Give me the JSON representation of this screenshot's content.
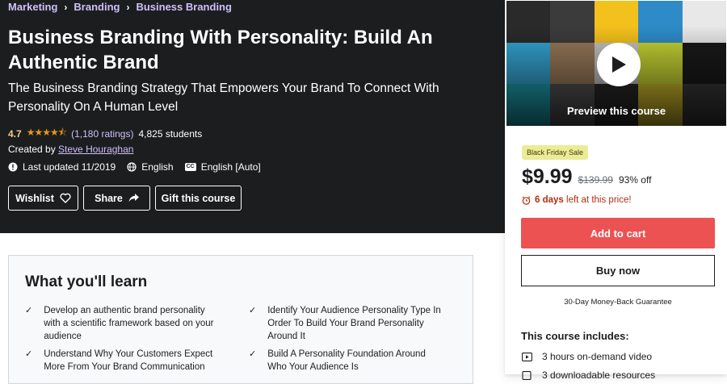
{
  "breadcrumb": [
    "Marketing",
    "Branding",
    "Business Branding"
  ],
  "course": {
    "title": "Business Branding With Personality: Build An Authentic Brand",
    "subtitle": "The Business Branding Strategy That Empowers Your Brand To Connect With Personality On A Human Level",
    "rating": "4.7",
    "rating_value": 4.7,
    "ratings_count": "(1,180 ratings)",
    "students": "4,825 students",
    "created_by_label": "Created by",
    "instructor": "Steve Houraghan",
    "last_updated": "Last updated 11/2019",
    "language": "English",
    "captions": "English [Auto]",
    "cc_label": "CC"
  },
  "actions": {
    "wishlist": "Wishlist",
    "share": "Share",
    "gift": "Gift this course"
  },
  "sidebar": {
    "preview_label": "Preview this course",
    "badge": "Black Friday Sale",
    "price": "$9.99",
    "original_price": "$139.99",
    "discount": "93% off",
    "timer_bold": "6 days",
    "timer_rest": "left at this price!",
    "add_to_cart": "Add to cart",
    "buy_now": "Buy now",
    "guarantee": "30-Day Money-Back Guarantee",
    "includes_title": "This course includes:",
    "includes": [
      "3 hours on-demand video",
      "3 downloadable resources"
    ]
  },
  "learn": {
    "heading": "What you'll learn",
    "items": [
      "Develop an authentic brand personality with a scientific framework based on your audience",
      "Identify Your Audience Personality Type In Order To Build Your Brand Personality Around It",
      "Understand Why Your Customers Expect More From Your Brand Communication",
      "Build A Personality Foundation Around Who Your Audience Is"
    ]
  },
  "colors": {
    "hero_bg": "#1c1d1f",
    "link_purple": "#cec0fc",
    "rating_gold": "#f3ca8c",
    "star_orange": "#e59819",
    "cart_red": "#ec5252",
    "timer_red": "#b32d0f",
    "badge_yellow": "#eceb98"
  },
  "icons": [
    "chevron-right-icon",
    "star-icon",
    "alert-icon",
    "globe-icon",
    "cc-icon",
    "heart-icon",
    "share-arrow-icon",
    "play-icon",
    "alarm-icon",
    "check-icon",
    "video-icon",
    "file-icon"
  ]
}
